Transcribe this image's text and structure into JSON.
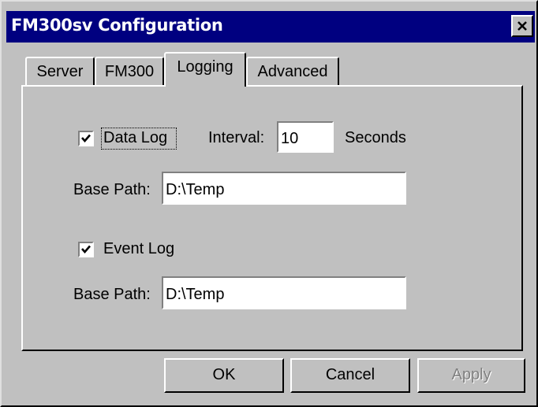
{
  "window": {
    "title": "FM300sv Configuration",
    "close_icon": "close-icon"
  },
  "tabs": [
    {
      "label": "Server",
      "active": false
    },
    {
      "label": "FM300",
      "active": false
    },
    {
      "label": "Logging",
      "active": true
    },
    {
      "label": "Advanced",
      "active": false
    }
  ],
  "logging": {
    "data_log": {
      "label": "Data Log",
      "checked": true,
      "interval_label": "Interval:",
      "interval_value": "10",
      "interval_unit": "Seconds",
      "base_path_label": "Base Path:",
      "base_path_value": "D:\\Temp"
    },
    "event_log": {
      "label": "Event Log",
      "checked": true,
      "base_path_label": "Base Path:",
      "base_path_value": "D:\\Temp"
    }
  },
  "buttons": {
    "ok": "OK",
    "cancel": "Cancel",
    "apply": "Apply",
    "apply_enabled": false
  },
  "colors": {
    "title_bar": "#000080",
    "face": "#c0c0c0"
  }
}
